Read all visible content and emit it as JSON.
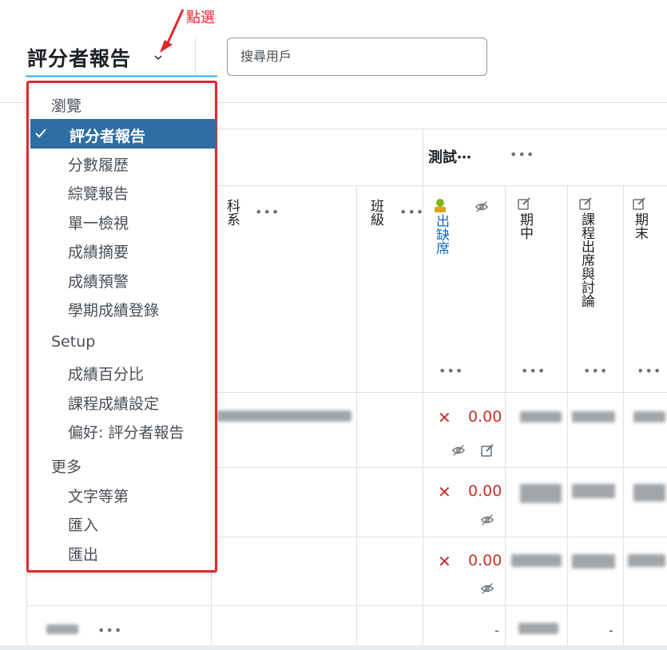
{
  "header": {
    "title": "評分者報告",
    "search_placeholder": "搜尋用戶",
    "annotation": "點選"
  },
  "grid": {
    "category_title": "測試⋯",
    "columns": [
      {
        "key": "dept",
        "label": "科系"
      },
      {
        "key": "class",
        "label": "班級"
      },
      {
        "key": "attendance",
        "label": "出缺席"
      },
      {
        "key": "midterm",
        "label": "期中"
      },
      {
        "key": "participation",
        "label": "課程出席與討論"
      },
      {
        "key": "final",
        "label": "期末"
      }
    ],
    "more": "•••",
    "rows": [
      {
        "cross": "✕",
        "score": "0.00"
      },
      {
        "cross": "✕",
        "score": "0.00"
      },
      {
        "cross": "✕",
        "score": "0.00"
      },
      {
        "attendance": "-",
        "participation": "-"
      }
    ]
  },
  "menu": {
    "groups": [
      {
        "label": "瀏覽",
        "items": [
          "評分者報告",
          "分數履歷",
          "綜覽報告",
          "單一檢視",
          "成績摘要",
          "成績預警",
          "學期成績登錄"
        ]
      },
      {
        "label": "Setup",
        "items": [
          "成績百分比",
          "課程成績設定",
          "偏好: 評分者報告"
        ]
      },
      {
        "label": "更多",
        "items": [
          "文字等第",
          "匯入",
          "匯出"
        ]
      }
    ],
    "active_item": "評分者報告"
  },
  "colors": {
    "highlight": "#e3262d",
    "active_bg": "#2f6ea3",
    "underline": "#6fc3f7",
    "score_red": "#c9302c"
  }
}
